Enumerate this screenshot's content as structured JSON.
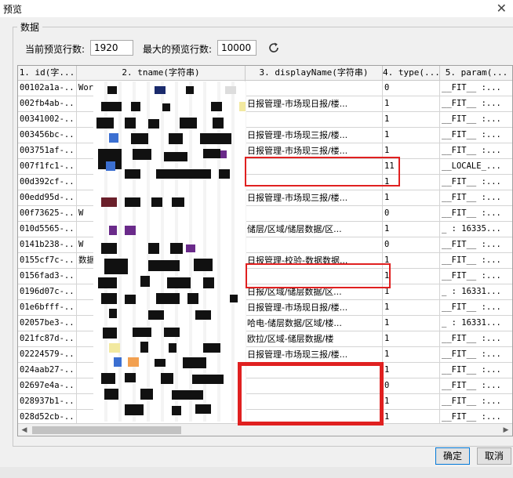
{
  "window": {
    "title": "预览"
  },
  "background": {
    "fragments": [
      "d_(",
      "d_(",
      "d_(",
      "ne",
      "d_",
      "d_f",
      "d_f",
      "t_(",
      "e_(",
      "d_(",
      "fai",
      "new",
      "ct",
      "lu",
      "nde",
      "int"
    ]
  },
  "group": {
    "label": "数据"
  },
  "controls": {
    "current_rows_label": "当前预览行数:",
    "current_rows_value": "1920",
    "max_rows_label": "最大的预览行数:",
    "max_rows_value": "10000",
    "refresh_icon": "refresh-icon"
  },
  "table": {
    "columns": [
      "1. id(字...",
      "2. tname(字符串)",
      "3. displayName(字符串)",
      "4. type(...",
      "5. param(..."
    ],
    "rows": [
      {
        "id": "00102a1a-...",
        "tname": "WorkBook61.cpt",
        "display": "",
        "type": "0",
        "param": "__FIT__ :..."
      },
      {
        "id": "002fb4ab-...",
        "tname": "",
        "display": "日报管理-市场现日报/楼...",
        "type": "1",
        "param": "__FIT__ :..."
      },
      {
        "id": "00341002-...",
        "tname": "",
        "display": "",
        "type": "1",
        "param": "__FIT__ :..."
      },
      {
        "id": "003456bc-...",
        "tname": "",
        "display": "日报管理-市场现三报/楼...",
        "type": "1",
        "param": "__FIT__ :..."
      },
      {
        "id": "003751af-...",
        "tname": "",
        "display": "日报管理-市场现三报/楼...",
        "type": "1",
        "param": "__FIT__ :..."
      },
      {
        "id": "007f1fc1-...",
        "tname": "",
        "display": "",
        "type": "11",
        "param": "__LOCALE_..."
      },
      {
        "id": "00d392cf-...",
        "tname": "",
        "display": "",
        "type": "1",
        "param": "__FIT__ :..."
      },
      {
        "id": "00edd95d-...",
        "tname": "",
        "display": "日报管理-市场现三报/楼...",
        "type": "1",
        "param": "__FIT__ :..."
      },
      {
        "id": "00f73625-...",
        "tname": "W",
        "display": "",
        "type": "0",
        "param": "__FIT__ :..."
      },
      {
        "id": "010d5565-...",
        "tname": "",
        "display": "储层/区域/储层数据/区...",
        "type": "1",
        "param": "_ : 16335..."
      },
      {
        "id": "0141b238-...",
        "tname": "W",
        "display": "",
        "type": "0",
        "param": "__FIT__ :..."
      },
      {
        "id": "0155cf7c-...",
        "tname": "数据-WEY...",
        "display": "日报管理-校验-数据数据...",
        "type": "1",
        "param": "__FIT__ :..."
      },
      {
        "id": "0156fad3-...",
        "tname": "",
        "display": "",
        "type": "1",
        "param": "__FIT__ :..."
      },
      {
        "id": "0196d07c-...",
        "tname": "",
        "display": "日报/区域/储层数据/区...",
        "type": "1",
        "param": "_ : 16331..."
      },
      {
        "id": "01e6bfff-...",
        "tname": "",
        "display": "日报管理-市场现日报/楼...",
        "type": "1",
        "param": "__FIT__ :..."
      },
      {
        "id": "02057be3-...",
        "tname": "",
        "display": "哈电-储层数据/区域/楼...",
        "type": "1",
        "param": "_ : 16331..."
      },
      {
        "id": "021fc87d-...",
        "tname": "",
        "display": "欧拉/区域-储层数据/楼",
        "type": "1",
        "param": "__FIT__ :..."
      },
      {
        "id": "02224579-...",
        "tname": "",
        "display": "日报管理-市场现三报/楼...",
        "type": "1",
        "param": "__FIT__ :..."
      },
      {
        "id": "024aab27-...",
        "tname": "",
        "display": "",
        "type": "1",
        "param": "__FIT__ :..."
      },
      {
        "id": "02697e4a-...",
        "tname": "",
        "display": "",
        "type": "0",
        "param": "__FIT__ :..."
      },
      {
        "id": "028937b1-...",
        "tname": "",
        "display": "",
        "type": "1",
        "param": "__FIT__ :..."
      },
      {
        "id": "028d52cb-...",
        "tname": "",
        "display": "",
        "type": "1",
        "param": "__FIT__ :..."
      }
    ]
  },
  "buttons": {
    "ok": "确定",
    "cancel": "取消"
  },
  "colors": {
    "highlight_box": "#e02020",
    "primary_border": "#0078d7"
  }
}
